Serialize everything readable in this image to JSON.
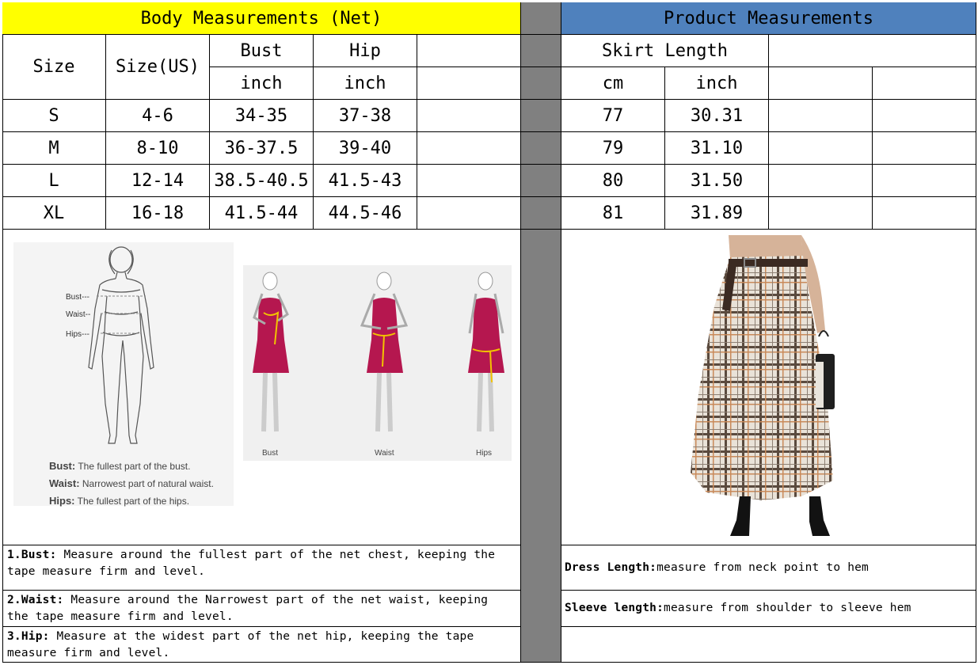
{
  "left": {
    "title": "Body Measurements (Net)",
    "headers": {
      "size": "Size",
      "size_us": "Size(US)",
      "bust": "Bust",
      "hip": "Hip",
      "bust_unit": "inch",
      "hip_unit": "inch"
    },
    "rows": [
      {
        "size": "S",
        "us": "4-6",
        "bust": "34-35",
        "hip": "37-38"
      },
      {
        "size": "M",
        "us": "8-10",
        "bust": "36-37.5",
        "hip": "39-40"
      },
      {
        "size": "L",
        "us": "12-14",
        "bust": "38.5-40.5",
        "hip": "41.5-43"
      },
      {
        "size": "XL",
        "us": "16-18",
        "bust": "41.5-44",
        "hip": "44.5-46"
      }
    ],
    "figure": {
      "labels": {
        "bust": "Bust---",
        "waist": "Waist--",
        "hips": "Hips---"
      },
      "legend": [
        {
          "term": "Bust:",
          "desc": "The fullest part of the bust."
        },
        {
          "term": "Waist:",
          "desc": "Narrowest part of natural waist."
        },
        {
          "term": "Hips:",
          "desc": "The fullest part of the hips."
        }
      ],
      "captions": [
        "Bust",
        "Waist",
        "Hips"
      ]
    },
    "notes": [
      {
        "term": "1.Bust:",
        "text": " Measure around the fullest part of the net chest, keeping the tape  measure firm and level."
      },
      {
        "term": "2.Waist:",
        "text": " Measure around the Narrowest part of the net waist, keeping the tape  measure firm and level."
      },
      {
        "term": "3.Hip:",
        "text": " Measure at the widest part of the net hip, keeping the tape measure firm and level."
      }
    ]
  },
  "right": {
    "title": "Product Measurements",
    "headers": {
      "skirt_length": "Skirt Length",
      "cm": "cm",
      "inch": "inch"
    },
    "rows": [
      {
        "cm": "77",
        "inch": "30.31"
      },
      {
        "cm": "79",
        "inch": "31.10"
      },
      {
        "cm": "80",
        "inch": "31.50"
      },
      {
        "cm": "81",
        "inch": "31.89"
      }
    ],
    "notes": [
      {
        "term": "Dress Length:",
        "text": " measure from neck point to hem"
      },
      {
        "term": "Sleeve length:",
        "text": " measure from shoulder to sleeve hem"
      },
      {
        "term": "",
        "text": ""
      }
    ]
  },
  "colors": {
    "header_left": "#ffff00",
    "header_right": "#4f81bd",
    "divider": "#808080",
    "dress": "#b5174f",
    "tape": "#f2c300"
  }
}
